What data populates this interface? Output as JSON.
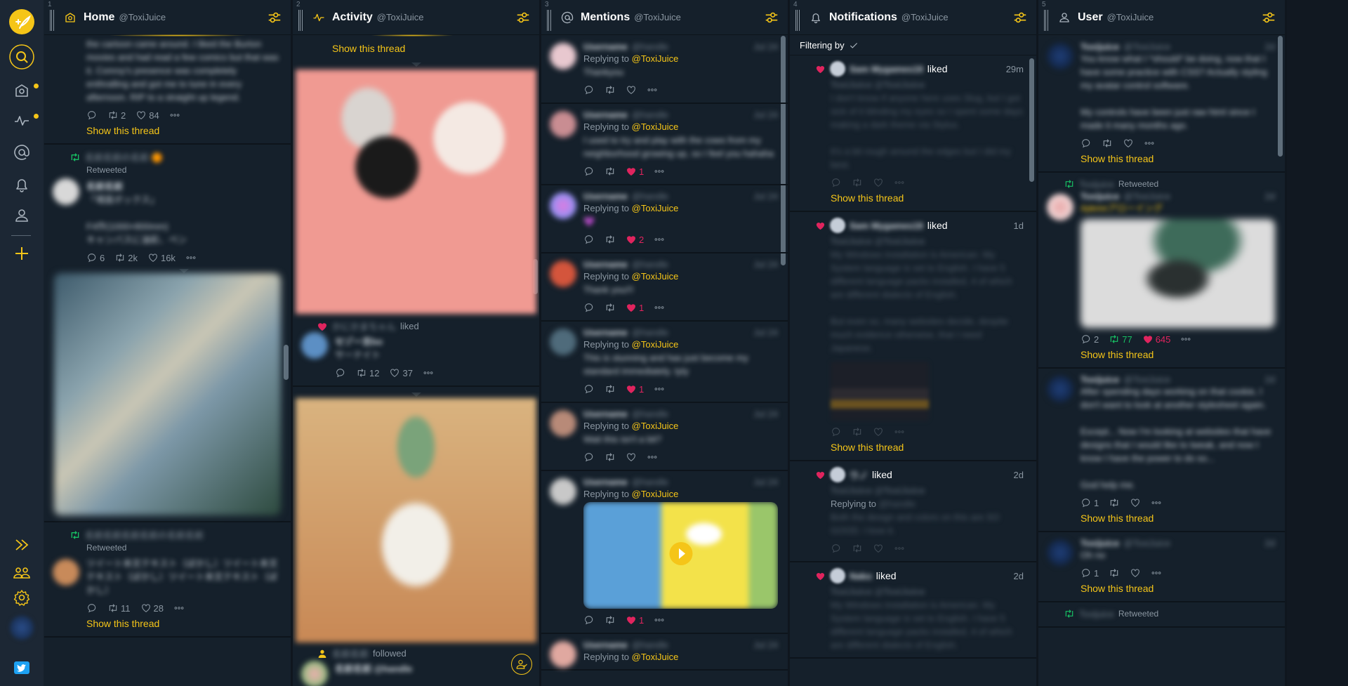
{
  "app": {
    "name": "Tweeten",
    "accent": "#f5c518",
    "like_color": "#e0245e",
    "retweet_color": "#17bf63"
  },
  "sidebar": {
    "top_items": [
      {
        "name": "compose",
        "icon": "compose-feather-icon"
      },
      {
        "name": "search",
        "icon": "search-icon"
      },
      {
        "name": "home",
        "icon": "home-icon",
        "unread": true
      },
      {
        "name": "activity",
        "icon": "activity-icon",
        "unread": true
      },
      {
        "name": "mentions",
        "icon": "at-icon"
      },
      {
        "name": "notifications",
        "icon": "bell-icon"
      },
      {
        "name": "user",
        "icon": "user-icon"
      },
      {
        "name": "add-column",
        "icon": "plus-icon"
      }
    ],
    "bottom_items": [
      {
        "name": "expand",
        "icon": "double-chevron-right-icon"
      },
      {
        "name": "accounts",
        "icon": "users-icon"
      },
      {
        "name": "settings",
        "icon": "gear-icon"
      },
      {
        "name": "profile",
        "icon": "avatar"
      },
      {
        "name": "twitter",
        "icon": "twitter-bird-icon"
      }
    ]
  },
  "columns": [
    {
      "number": "1",
      "title": "Home",
      "handle": "@ToxiJuice",
      "tweets": [
        {
          "type": "partial",
          "text": "the cartoon came around. I liked the Burton movies and had read a few comics but that was it. Conroy's presence was completely enthralling and got me to tune in every afternoon. RIP to a straight up legend.",
          "reply": "",
          "retweets": "2",
          "likes": "84",
          "show_thread": "Show this thread"
        },
        {
          "type": "retweet",
          "retweeted_label": "Retweeted",
          "name": "名前名前",
          "text": "「場面ボックス」\n\nF4作(1000×800mm)\nキャンバスに油彩、ペン",
          "reply": "6",
          "retweets": "2k",
          "likes": "16k"
        },
        {
          "type": "retweet",
          "retweeted_label": "Retweeted",
          "name": "名前名前",
          "text": "ツイート本文テキスト（ぼかし）ツイート本文テキスト（ぼかし）ツイート本文テキスト（ぼかし）",
          "reply": "",
          "retweets": "11",
          "likes": "28",
          "show_thread": "Show this thread"
        }
      ]
    },
    {
      "number": "2",
      "title": "Activity",
      "handle": "@ToxiJuice",
      "show_thread_top": "Show this thread",
      "liked_label": "liked",
      "liked_item": {
        "text": "サーナイト",
        "reply": "",
        "retweets": "12",
        "likes": "37"
      },
      "followed_label": "followed"
    },
    {
      "number": "3",
      "title": "Mentions",
      "handle": "@ToxiJuice",
      "replying_label": "Replying to",
      "replying_handle": "@ToxiJuice",
      "tweets": [
        {
          "text": "Thankyou",
          "likes": "",
          "liked": false
        },
        {
          "text": "I used to try and play with the cows from my neighborhood growing up, so I feel you hahaha",
          "likes": "1",
          "liked": true
        },
        {
          "text": "💜",
          "likes": "2",
          "liked": true
        },
        {
          "text": "Thank you!!!",
          "likes": "1",
          "liked": true
        },
        {
          "text": "This is stunning and has just become my standard immediately. tyty",
          "likes": "1",
          "liked": true
        },
        {
          "text": "Wait this isn't a bit?",
          "likes": "",
          "liked": false
        },
        {
          "text": "",
          "media": "video",
          "likes": "1",
          "liked": true
        },
        {
          "text": "",
          "likes": "",
          "liked": false
        }
      ]
    },
    {
      "number": "4",
      "title": "Notifications",
      "handle": "@ToxiJuice",
      "filter_label": "Filtering by",
      "items": [
        {
          "user": "Sam Mygames19",
          "action": "liked",
          "time": "29m",
          "text": "I don't know if anyone here uses Slug, but I got sick of it blinding my eyes so I spent some days making a dark theme via Stylus.\n\nIt's a bit rough around the edges but I did my best.",
          "show_thread": "Show this thread"
        },
        {
          "user": "Sam Mygames19",
          "action": "liked",
          "time": "1d",
          "text": "My Windows installation is American. My System language is set to English. I have 5 different language packs installed, 4 of which are different dialects of English.\n\nBut even so, many websites decide, despite much evidence otherwise, that I need Japanese.",
          "show_thread": "Show this thread"
        },
        {
          "user": "ウノ",
          "action": "liked",
          "time": "2d",
          "replying": "Replying to",
          "text": "Both the design and colors on this are SO GOOD. I love it."
        },
        {
          "user": "Nako",
          "action": "liked",
          "time": "2d",
          "text": "My Windows installation is American. My System language is set to English. I have 5 different language packs installed, 4 of which are different dialects of English."
        }
      ]
    },
    {
      "number": "5",
      "title": "User",
      "handle": "@ToxiJuice",
      "tweets": [
        {
          "text": "You know what I *should* be doing, now that I have some practice with CSS? Actually styling my avatar control software.\n\nMy controls have been just raw html since I made it many months ago.",
          "reply": "",
          "retweets": "",
          "likes": "",
          "show_thread": "Show this thread"
        },
        {
          "type": "retweet",
          "retweeted_label": "Retweeted",
          "text": "#pkmnアローイング",
          "reply": "2",
          "retweets": "77",
          "likes": "645",
          "show_thread": "Show this thread"
        },
        {
          "text": "After spending days working on that cookie, I don't want to look at another stylesheet again.\n\nExcept... Now I'm looking at websites that have designs that I would like to tweak, and now I know I have the power to do so...\n\nGod help me.",
          "reply": "1",
          "retweets": "",
          "likes": "",
          "show_thread": "Show this thread"
        },
        {
          "text": "Oh no",
          "reply": "1",
          "retweets": "",
          "likes": "",
          "show_thread": "Show this thread"
        },
        {
          "type": "retweet",
          "retweeted_label": "Retweeted"
        }
      ]
    }
  ]
}
